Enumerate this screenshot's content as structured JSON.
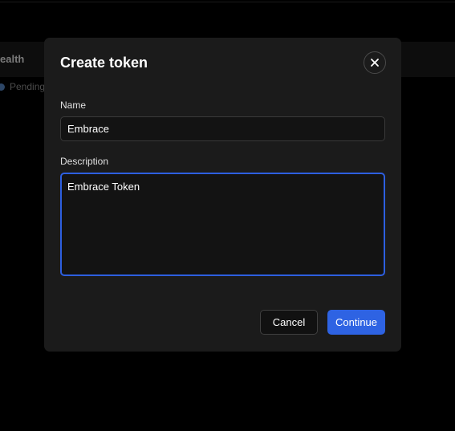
{
  "background": {
    "column_label": "ealth",
    "status_text": "Pending"
  },
  "modal": {
    "title": "Create token",
    "close_icon": "close-icon",
    "name_label": "Name",
    "name_value": "Embrace",
    "description_label": "Description",
    "description_value": "Embrace Token",
    "cancel_label": "Cancel",
    "continue_label": "Continue"
  },
  "colors": {
    "accent": "#2e63e3",
    "modal_background": "#1b1b1b",
    "input_background": "#131313"
  }
}
